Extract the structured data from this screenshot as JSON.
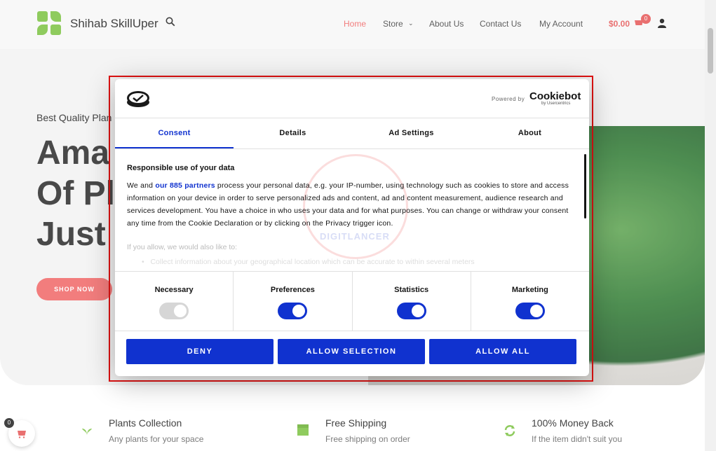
{
  "site": {
    "title": "Shihab SkillUper",
    "nav": [
      "Home",
      "Store",
      "About Us",
      "Contact Us",
      "My Account"
    ],
    "cart_price": "$0.00",
    "cart_count": "0"
  },
  "hero": {
    "subtitle": "Best Quality Plan",
    "title": "Ama\nOf Pl\nJust",
    "button": "SHOP NOW"
  },
  "features": [
    {
      "title": "Plants Collection",
      "desc": "Any plants for your space"
    },
    {
      "title": "Free Shipping",
      "desc": "Free shipping on order"
    },
    {
      "title": "100% Money Back",
      "desc": "If the item didn't suit you"
    }
  ],
  "float_cart_count": "0",
  "dialog": {
    "powered_by": "Powered by",
    "brand": "Cookiebot",
    "brand_sub": "by Usercentrics",
    "tabs": [
      "Consent",
      "Details",
      "Ad Settings",
      "About"
    ],
    "heading": "Responsible use of your data",
    "body_pre": "We and ",
    "body_link": "our 885 partners",
    "body_post": " process your personal data, e.g. your IP-number, using technology such as cookies to store and access information on your device in order to serve personalized ads and content, ad and content measurement, audience research and services development. You have a choice in who uses your data and for what purposes. You can change or withdraw your consent any time from the Cookie Declaration or by clicking on the Privacy trigger icon.",
    "more": "If you allow, we would also like to:",
    "bullet": "Collect information about your geographical location which can be accurate to within several meters",
    "watermark": "DIGITLANCER",
    "toggles": [
      {
        "label": "Necessary",
        "on": true,
        "disabled": true
      },
      {
        "label": "Preferences",
        "on": true
      },
      {
        "label": "Statistics",
        "on": true
      },
      {
        "label": "Marketing",
        "on": true
      }
    ],
    "buttons": {
      "deny": "DENY",
      "allow_selection": "ALLOW SELECTION",
      "allow_all": "ALLOW ALL"
    }
  },
  "colors": {
    "accent": "#1032cf",
    "brand_red": "#f06767",
    "highlight": "#e01212",
    "green": "#7cc242"
  }
}
